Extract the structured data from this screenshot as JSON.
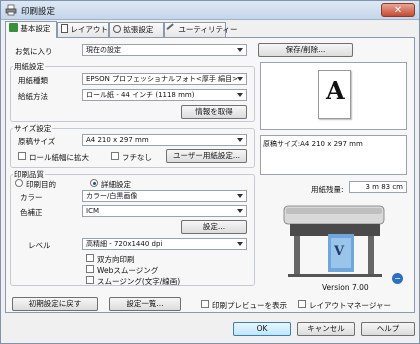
{
  "window": {
    "title": "印刷設定",
    "close_label": "✕"
  },
  "tabs": [
    {
      "label": "基本設定"
    },
    {
      "label": "レイアウト"
    },
    {
      "label": "拡張設定"
    },
    {
      "label": "ユーティリティー"
    }
  ],
  "favorites": {
    "label": "お気に入り",
    "value": "現在の設定",
    "save_button": "保存/削除..."
  },
  "paper": {
    "group_label": "用紙設定",
    "type_label": "用紙種類",
    "type_value": "EPSON プロフェッショナルフォト<厚手 絹目>",
    "feed_label": "給紙方法",
    "feed_value": "ロール紙 - 44 インチ (1118 mm)",
    "info_button": "情報を取得"
  },
  "size": {
    "group_label": "サイズ設定",
    "source_label": "原稿サイズ",
    "source_value": "A4 210 x 297 mm",
    "fit_roll_label": "ロール紙幅に拡大",
    "borderless_label": "フチなし",
    "user_paper_button": "ユーザー用紙設定..."
  },
  "quality": {
    "group_label": "印刷品質",
    "purpose_label": "印刷目的",
    "detail_label": "詳細設定",
    "color_label": "カラー",
    "color_value": "カラー/白黒画像",
    "colorcorr_label": "色補正",
    "colorcorr_value": "ICM",
    "settings_button": "設定...",
    "level_label": "レベル",
    "level_value": "高精細 - 720x1440 dpi",
    "bidir_label": "双方向印刷",
    "web_smooth_label": "Webスムージング",
    "text_smooth_label": "スムージング(文字/線画)"
  },
  "preview": {
    "letter": "A",
    "info_text": "原稿サイズ:A4 210 x 297 mm",
    "remaining_label": "用紙残量:",
    "remaining_value": "3 m 83 cm",
    "printer_letter": "V",
    "version": "Version 7.00"
  },
  "bottom": {
    "reset_button": "初期設定に戻す",
    "list_button": "設定一覧...",
    "print_preview_label": "印刷プレビューを表示",
    "layout_manager_label": "レイアウトマネージャー"
  },
  "dialog": {
    "ok": "OK",
    "cancel": "キャンセル",
    "help": "ヘルプ"
  },
  "colors": {
    "accent": "#3c7fb1",
    "close": "#c44a32"
  }
}
